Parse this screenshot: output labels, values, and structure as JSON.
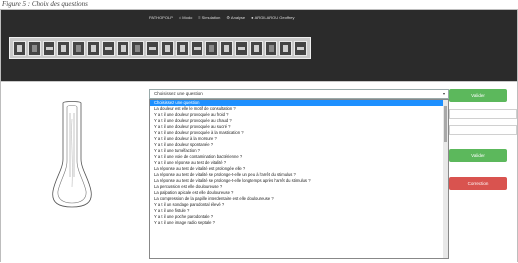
{
  "caption": "Figure 5 : Choix des questions",
  "navbar": {
    "brand": "PATHOPOLP",
    "items": [
      {
        "icon": "home-icon",
        "label": "Modo"
      },
      {
        "icon": "list-icon",
        "label": "Simulation"
      },
      {
        "icon": "gear-icon",
        "label": "Analyse"
      },
      {
        "icon": "user-icon",
        "label": "ARGILAROU Geoffrey"
      }
    ]
  },
  "toolbar": {
    "tools": [
      "tool-1",
      "tool-2",
      "tool-3",
      "tool-4",
      "tool-5",
      "tool-6",
      "tool-7",
      "tool-8",
      "tool-9",
      "tool-10",
      "tool-11",
      "tool-12",
      "tool-13",
      "tool-14",
      "tool-15",
      "tool-16",
      "tool-17",
      "tool-18",
      "tool-19",
      "tool-20"
    ]
  },
  "question_select": {
    "value": "Choisissez une question",
    "arrow": "▾"
  },
  "question_options": [
    "Choisissez une question",
    "La douleur est elle le motif de consultation ?",
    "Y a t il une douleur provoquée au froid ?",
    "Y a t il une douleur provoquée au chaud ?",
    "Y a t il une douleur provoquée au sucré ?",
    "Y a t il une douleur provoquée à la mastication ?",
    "Y a t il une douleur à la morsure ?",
    "Y a t il une douleur spontanée ?",
    "Y a t il une tuméfaction ?",
    "Y a t il une voie de contamination bactérienne ?",
    "Y a t il une réponse au test de vitalité ?",
    "La réponse au test de vitalité est prolongée elle ?",
    "La réponse au test de vitalité se prolonge-t-elle un peu à l'arrêt du stimulus ?",
    "La réponse au test de vitalité se prolonge-t-elle longtemps après l'arrêt du stimulus ?",
    "La percussion est elle douloureuse ?",
    "La palpation apicale est elle douloureuse ?",
    "La compression de la papille interdentaire est elle douloureuse ?",
    "Y a t il un sondage parodontal élevé ?",
    "Y a t il une fistule ?",
    "Y a t il une poche parodontale ?",
    "Y a t il une image radio septale ?"
  ],
  "buttons": {
    "valider_1": "Valider",
    "valider_2": "Valider",
    "correction": "Correction"
  },
  "colors": {
    "navbar": "#2b2b2b",
    "selected_option": "#1e90ff",
    "green_button": "#5cb85c",
    "red_button": "#d9534f"
  }
}
